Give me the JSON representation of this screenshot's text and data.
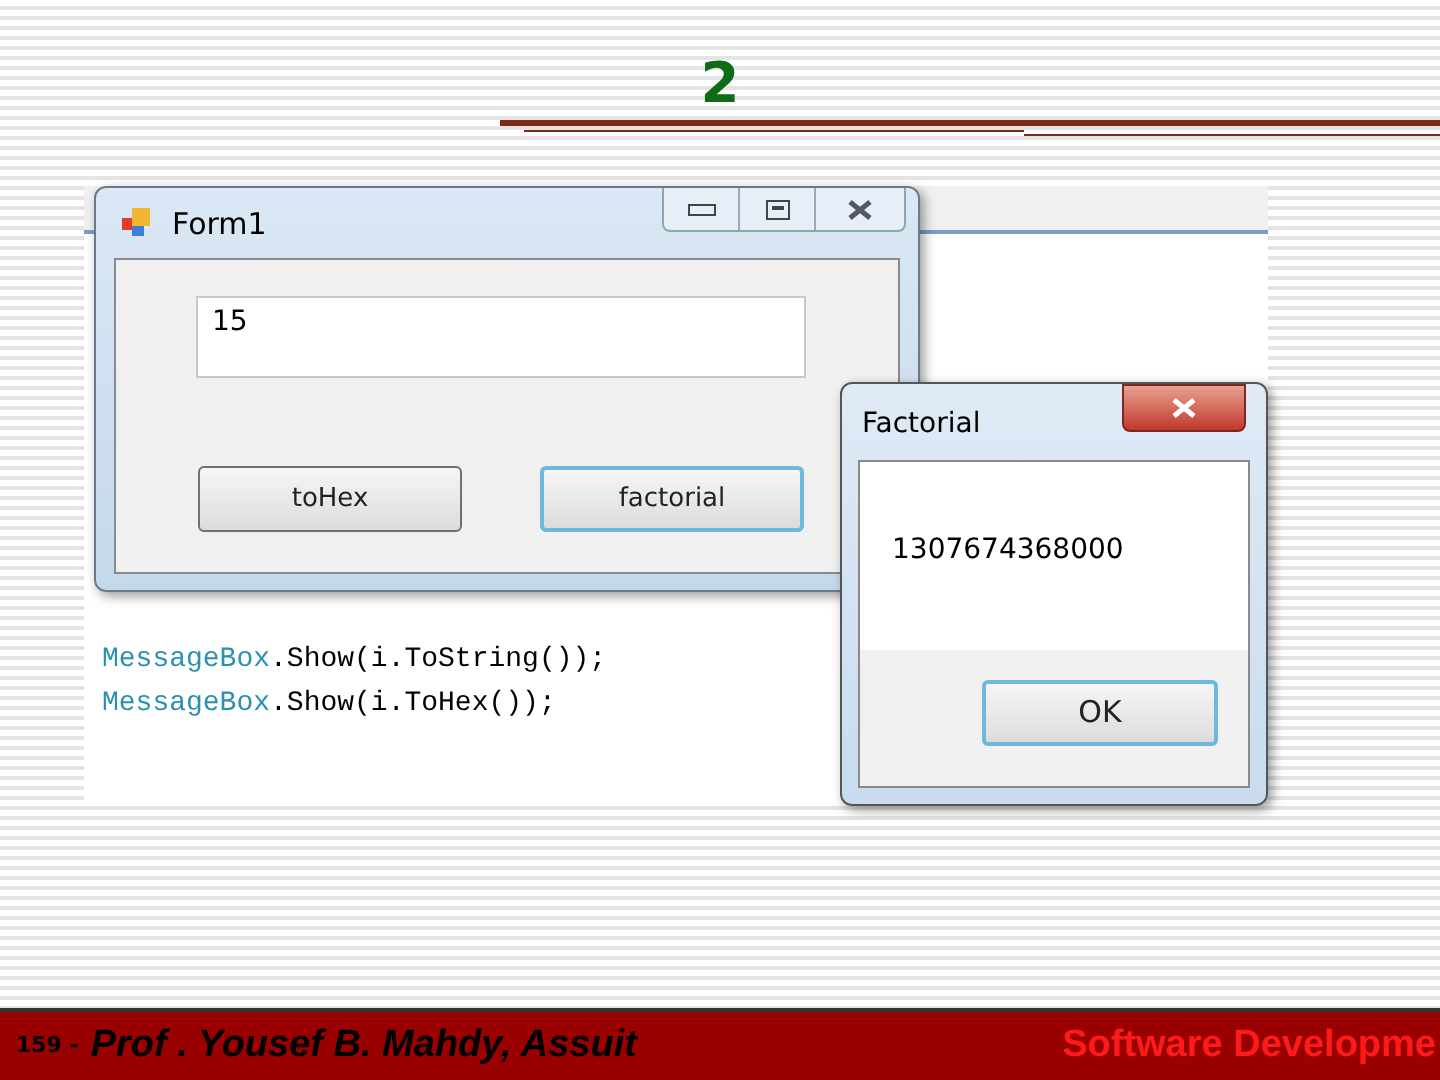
{
  "slide": {
    "title": "2"
  },
  "screenshot": {
    "code_lines": [
      [
        {
          "text": "MessageBox",
          "kind": "type"
        },
        {
          "text": ".Show(i.ToString());",
          "kind": "plain"
        }
      ],
      [
        {
          "text": "MessageBox",
          "kind": "type"
        },
        {
          "text": ".Show(i.ToHex());",
          "kind": "plain"
        }
      ]
    ],
    "form_window": {
      "title": "Form1",
      "text_field": {
        "value": "15"
      },
      "buttons": [
        {
          "label": "toHex",
          "selected": false
        },
        {
          "label": "factorial",
          "selected": true
        }
      ]
    },
    "message_box": {
      "title": "Factorial",
      "message": "1307674368000",
      "buttons": [
        {
          "label": "OK",
          "selected": true
        }
      ]
    }
  },
  "footer": {
    "page": "159 -",
    "author": "Prof . Yousef  B. Mahdy, Assuit",
    "course": "Software Developme"
  }
}
